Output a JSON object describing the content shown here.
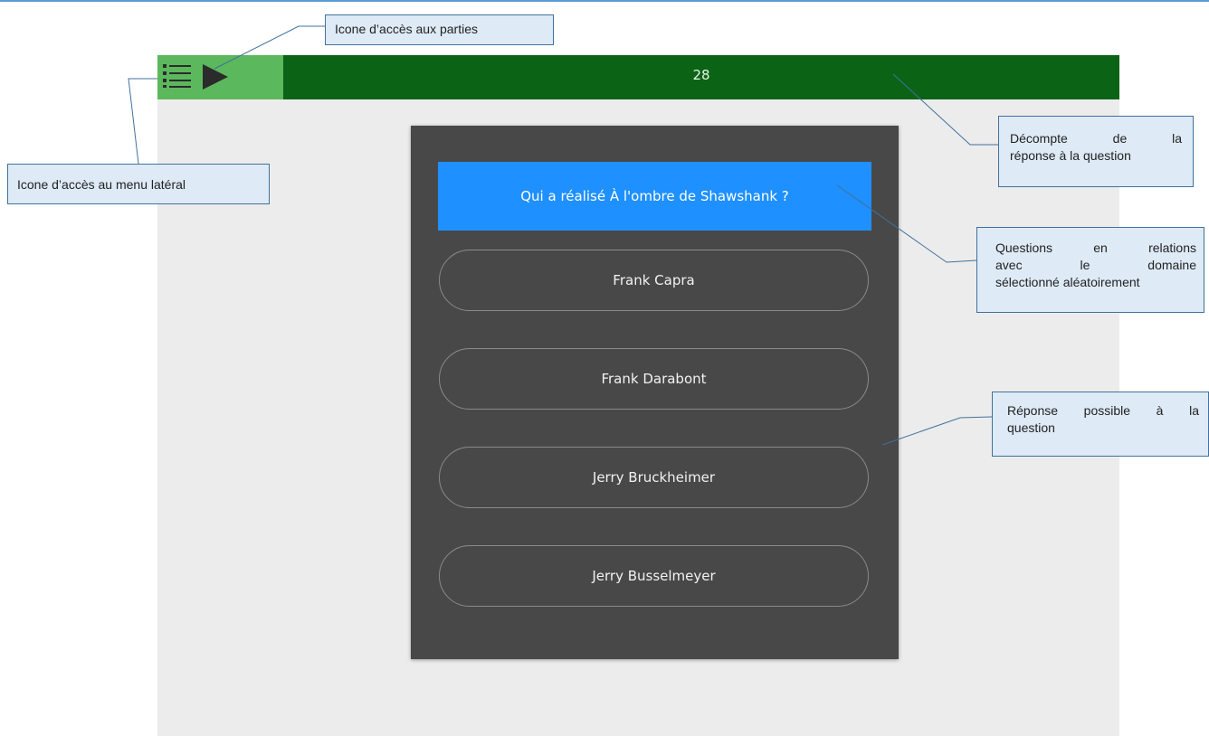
{
  "app": {
    "timer": "28",
    "question": "Qui a réalisé À l'ombre de Shawshank ?",
    "answers": [
      "Frank Capra",
      "Frank Darabont",
      "Jerry Bruckheimer",
      "Jerry Busselmeyer"
    ],
    "icons": {
      "menu": "list-menu-icon",
      "play": "play-icon"
    },
    "colors": {
      "topbar_left": "#5cb85c",
      "topbar_right": "#0b6416",
      "card": "#484848",
      "question_bg": "#1e90ff"
    }
  },
  "annotations": {
    "parties_icon": "Icone d’accès aux parties",
    "menu_icon": "Icone d’accès au menu latéral",
    "countdown_line1": "Décompte de la",
    "countdown_line2": "réponse à la question",
    "questions_line1": "Questions en relations",
    "questions_line2": "avec le domaine",
    "questions_line3": "sélectionné aléatoirement",
    "answer_line1": "Réponse possible à la",
    "answer_line2": "question"
  }
}
